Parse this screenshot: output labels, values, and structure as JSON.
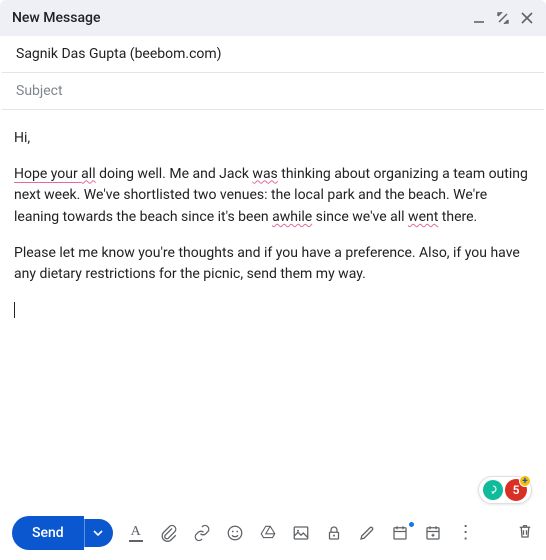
{
  "header": {
    "title": "New Message"
  },
  "recipient": "Sagnik Das Gupta (beebom.com)",
  "subject_placeholder": "Subject",
  "body": {
    "greeting": "Hi,",
    "p1a": "Hope your ",
    "p1_err1": "all",
    "p1b": " doing well. Me and Jack ",
    "p1_err2": "was",
    "p1c": " thinking about organizing a team outing next week. We've shortlisted two venues: the local park and the beach. We're leaning towards the beach since it's been ",
    "p1_err3": "awhile",
    "p1d": " since we've all ",
    "p1_err4": "went",
    "p1e": " there.",
    "p2": "Please let me know you're thoughts and if you have a preference. Also, if you have any dietary restrictions for the picnic, send them my way."
  },
  "extension": {
    "error_count": "5",
    "plus": "+"
  },
  "toolbar": {
    "send_label": "Send",
    "confidential_letter": "A"
  }
}
